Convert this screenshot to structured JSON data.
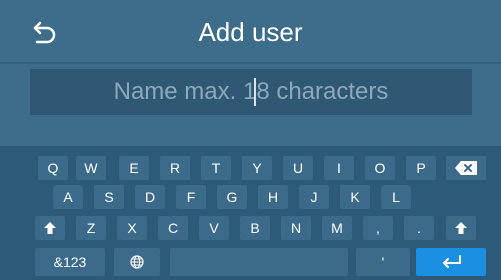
{
  "header": {
    "title": "Add user",
    "back_icon": "back-arrow-icon"
  },
  "name_field": {
    "value": "",
    "placeholder": "Name max. 18 characters"
  },
  "keyboard": {
    "row1": [
      "Q",
      "W",
      "E",
      "R",
      "T",
      "Y",
      "U",
      "I",
      "O",
      "P"
    ],
    "row2": [
      "A",
      "S",
      "D",
      "F",
      "G",
      "H",
      "J",
      "K",
      "L"
    ],
    "row3": [
      "Z",
      "X",
      "C",
      "V",
      "B",
      "N",
      "M",
      ",",
      "."
    ],
    "mode_key": "&123",
    "apostrophe_key": "'",
    "icons": [
      "backspace-icon",
      "shift-icon",
      "globe-icon",
      "enter-icon"
    ],
    "colors": {
      "key": "#3c6a8b",
      "keyboard_bg": "#2e5a79",
      "enter": "#1b8fe0"
    }
  }
}
